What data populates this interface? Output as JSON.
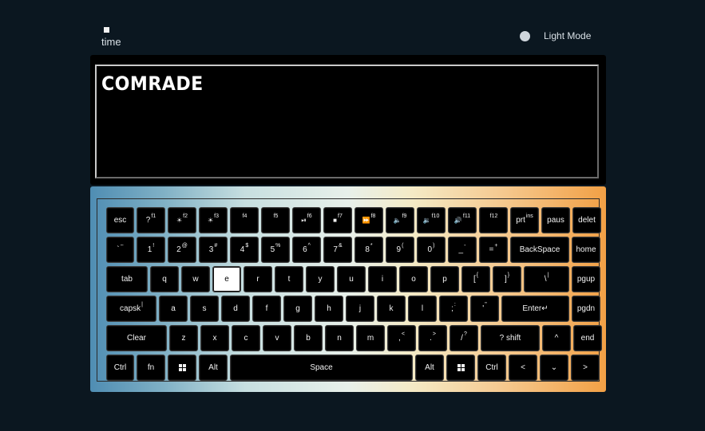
{
  "header": {
    "time_label": "time",
    "mode_toggle_label": "Light Mode"
  },
  "display": {
    "typed_text": "COMRADE"
  },
  "keyboard": {
    "active_key": "e",
    "rows": [
      [
        {
          "label": "esc",
          "sup": "",
          "w": 35
        },
        {
          "label": "?",
          "sup": "f1",
          "w": 36
        },
        {
          "label": "☀",
          "sup": "f2",
          "w": 36
        },
        {
          "label": "☀",
          "sup": "f3",
          "w": 36
        },
        {
          "label": "",
          "sup": "f4",
          "w": 36
        },
        {
          "label": "",
          "sup": "f5",
          "w": 36
        },
        {
          "label": "⏯",
          "sup": "f6",
          "w": 36
        },
        {
          "label": "■",
          "sup": "f7",
          "w": 36
        },
        {
          "label": "⏩",
          "sup": "f8",
          "w": 36
        },
        {
          "label": "🔈",
          "sup": "f9",
          "w": 36
        },
        {
          "label": "🔉",
          "sup": "f10",
          "w": 36
        },
        {
          "label": "🔊",
          "sup": "f11",
          "w": 36
        },
        {
          "label": "",
          "sup": "f12",
          "w": 36
        },
        {
          "label": "prt",
          "sup": "ins",
          "w": 36
        },
        {
          "label": "paus",
          "sup": "",
          "w": 36
        },
        {
          "label": "delet",
          "sup": "",
          "w": 36
        }
      ],
      [
        {
          "label": "`",
          "sup": "~",
          "w": 35
        },
        {
          "label": "1",
          "sup": "!",
          "w": 36
        },
        {
          "label": "2",
          "sup": "@",
          "w": 36
        },
        {
          "label": "3",
          "sup": "#",
          "w": 36
        },
        {
          "label": "4",
          "sup": "$",
          "w": 36
        },
        {
          "label": "5",
          "sup": "%",
          "w": 36
        },
        {
          "label": "6",
          "sup": "^",
          "w": 36
        },
        {
          "label": "7",
          "sup": "&",
          "w": 36
        },
        {
          "label": "8",
          "sup": "*",
          "w": 36
        },
        {
          "label": "9",
          "sup": "(",
          "w": 36
        },
        {
          "label": "0",
          "sup": ")",
          "w": 36
        },
        {
          "label": "_",
          "sup": "-",
          "w": 36
        },
        {
          "label": "=",
          "sup": "+",
          "w": 36
        },
        {
          "label": "BackSpace",
          "sup": "",
          "w": 74
        },
        {
          "label": "home",
          "sup": "",
          "w": 36
        }
      ],
      [
        {
          "label": "tab",
          "sup": "",
          "w": 52
        },
        {
          "label": "q",
          "sup": "",
          "w": 36
        },
        {
          "label": "w",
          "sup": "",
          "w": 36
        },
        {
          "label": "e",
          "sup": "",
          "w": 36
        },
        {
          "label": "r",
          "sup": "",
          "w": 36
        },
        {
          "label": "t",
          "sup": "",
          "w": 36
        },
        {
          "label": "y",
          "sup": "",
          "w": 36
        },
        {
          "label": "u",
          "sup": "",
          "w": 36
        },
        {
          "label": "i",
          "sup": "",
          "w": 36
        },
        {
          "label": "o",
          "sup": "",
          "w": 36
        },
        {
          "label": "p",
          "sup": "",
          "w": 36
        },
        {
          "label": "[",
          "sup": "{",
          "w": 36
        },
        {
          "label": "]",
          "sup": "}",
          "w": 36
        },
        {
          "label": "\\",
          "sup": "|",
          "w": 57
        },
        {
          "label": "pgup",
          "sup": "",
          "w": 36
        }
      ],
      [
        {
          "label": "capsk",
          "sup": "|",
          "w": 63
        },
        {
          "label": "a",
          "sup": "",
          "w": 36
        },
        {
          "label": "s",
          "sup": "",
          "w": 36
        },
        {
          "label": "d",
          "sup": "",
          "w": 36
        },
        {
          "label": "f",
          "sup": "",
          "w": 36
        },
        {
          "label": "g",
          "sup": "",
          "w": 36
        },
        {
          "label": "h",
          "sup": "",
          "w": 36
        },
        {
          "label": "j",
          "sup": "",
          "w": 36
        },
        {
          "label": "k",
          "sup": "",
          "w": 36
        },
        {
          "label": "l",
          "sup": "",
          "w": 36
        },
        {
          "label": ";",
          "sup": ":",
          "w": 36
        },
        {
          "label": "'",
          "sup": "\"",
          "w": 36
        },
        {
          "label": "Enter↵",
          "sup": "",
          "w": 85
        },
        {
          "label": "pgdn",
          "sup": "",
          "w": 36
        }
      ],
      [
        {
          "label": "Clear",
          "sup": "",
          "w": 76
        },
        {
          "label": "z",
          "sup": "",
          "w": 36
        },
        {
          "label": "x",
          "sup": "",
          "w": 36
        },
        {
          "label": "c",
          "sup": "",
          "w": 36
        },
        {
          "label": "v",
          "sup": "",
          "w": 36
        },
        {
          "label": "b",
          "sup": "",
          "w": 36
        },
        {
          "label": "n",
          "sup": "",
          "w": 36
        },
        {
          "label": "m",
          "sup": "",
          "w": 36
        },
        {
          "label": ",",
          "sup": "<",
          "w": 36
        },
        {
          "label": ".",
          "sup": ">",
          "w": 36
        },
        {
          "label": "/",
          "sup": "?",
          "w": 36
        },
        {
          "label": "? shift",
          "sup": "",
          "w": 74
        },
        {
          "label": "^",
          "sup": "",
          "w": 36
        },
        {
          "label": "end",
          "sup": "",
          "w": 36
        }
      ],
      [
        {
          "label": "Ctrl",
          "sup": "",
          "w": 35
        },
        {
          "label": "fn",
          "sup": "",
          "w": 36
        },
        {
          "label": "win",
          "sup": "",
          "w": 36
        },
        {
          "label": "Alt",
          "sup": "",
          "w": 36
        },
        {
          "label": "Space",
          "sup": "",
          "w": 229
        },
        {
          "label": "Alt",
          "sup": "",
          "w": 36
        },
        {
          "label": "win",
          "sup": "",
          "w": 36
        },
        {
          "label": "Ctrl",
          "sup": "",
          "w": 36
        },
        {
          "label": "<",
          "sup": "",
          "w": 36
        },
        {
          "label": "⌄",
          "sup": "",
          "w": 36
        },
        {
          "label": ">",
          "sup": "",
          "w": 36
        }
      ]
    ]
  }
}
